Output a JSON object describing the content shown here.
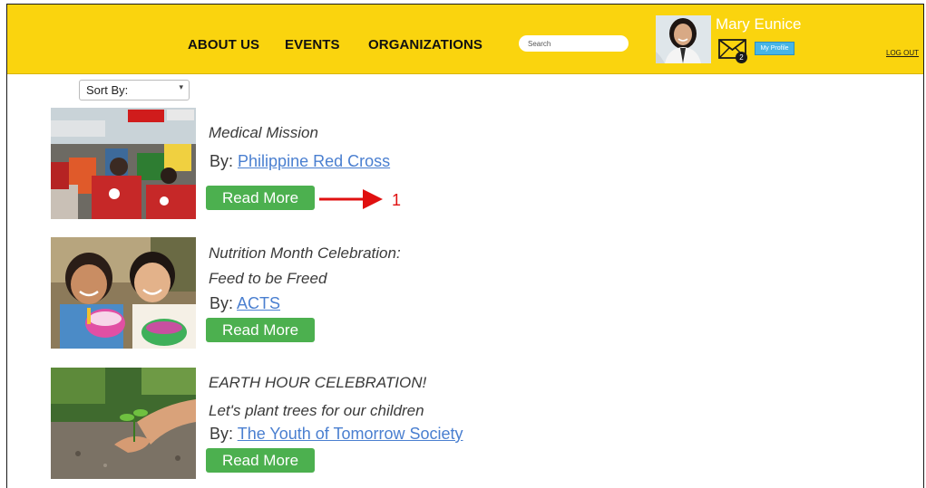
{
  "header": {
    "nav": [
      "ABOUT US",
      "EVENTS",
      "ORGANIZATIONS"
    ],
    "search_placeholder": "Search",
    "username": "Mary Eunice",
    "mail_count": "2",
    "profile_button": "My Profile",
    "logout": "LOG OUT"
  },
  "sort": {
    "label": "Sort By:",
    "caret_icon": "chevron-down-icon"
  },
  "events": [
    {
      "title_lines": [
        "Medical Mission"
      ],
      "by_label": "By:",
      "organizer": "Philippine Red Cross",
      "read_more": "Read More",
      "image": "medical-mission-photo"
    },
    {
      "title_lines": [
        "Nutrition Month Celebration:",
        "Feed to be Freed"
      ],
      "by_label": "By:",
      "organizer": "ACTS",
      "read_more": "Read More",
      "image": "children-eating-photo"
    },
    {
      "title_lines": [
        "EARTH HOUR CELEBRATION!",
        "Let's plant trees for our children"
      ],
      "by_label": "By:",
      "organizer": "The Youth of Tomorrow Society",
      "read_more": "Read More",
      "image": "tree-planting-photo"
    }
  ],
  "annotation": {
    "number": "1",
    "color": "#e01010"
  },
  "colors": {
    "header_bg": "#fad40e",
    "button_green": "#4cb04f",
    "link_blue": "#4a7fd0",
    "profile_blue": "#47b5e6"
  }
}
